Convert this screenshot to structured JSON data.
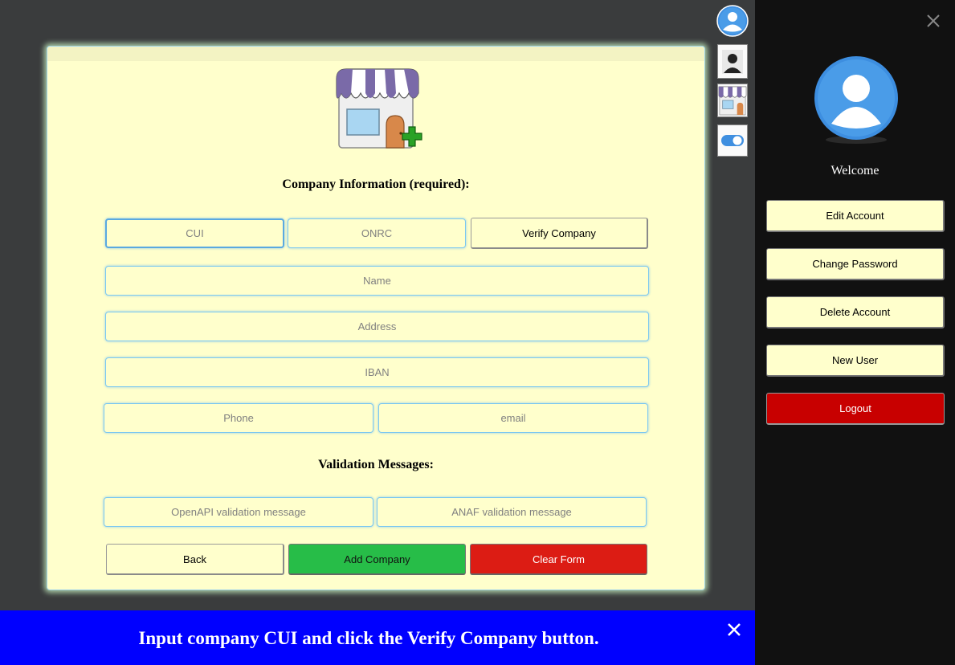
{
  "form": {
    "heading": "Company Information (required):",
    "fields": {
      "cui": {
        "placeholder": "CUI",
        "value": ""
      },
      "onrc": {
        "placeholder": "ONRC",
        "value": ""
      },
      "name": {
        "placeholder": "Name",
        "value": ""
      },
      "address": {
        "placeholder": "Address",
        "value": ""
      },
      "iban": {
        "placeholder": "IBAN",
        "value": ""
      },
      "phone": {
        "placeholder": "Phone",
        "value": ""
      },
      "email": {
        "placeholder": "email",
        "value": ""
      }
    },
    "verify_label": "Verify Company",
    "validation_heading": "Validation Messages:",
    "validation": {
      "openapi": {
        "placeholder": "OpenAPI validation message",
        "value": ""
      },
      "anaf": {
        "placeholder": "ANAF validation message",
        "value": ""
      }
    },
    "actions": {
      "back": "Back",
      "add": "Add Company",
      "clear": "Clear Form"
    }
  },
  "toolbar": {
    "icons": [
      "user-avatar-icon",
      "user-silhouette-icon",
      "add-store-icon",
      "toggle-switch-icon"
    ]
  },
  "sidebar": {
    "welcome": "Welcome",
    "buttons": {
      "edit_account": "Edit Account",
      "change_password": "Change Password",
      "delete_account": "Delete Account",
      "new_user": "New User",
      "logout": "Logout"
    }
  },
  "banner": {
    "message": "Input company CUI and click the Verify Company button."
  },
  "colors": {
    "panel_bg": "#ffffcc",
    "add_button": "#27bd48",
    "clear_button": "#dc1c14",
    "logout_button": "#c80000",
    "banner_bg": "#0000ff",
    "sidebar_bg": "#111111",
    "page_bg": "#3a3c3d"
  }
}
